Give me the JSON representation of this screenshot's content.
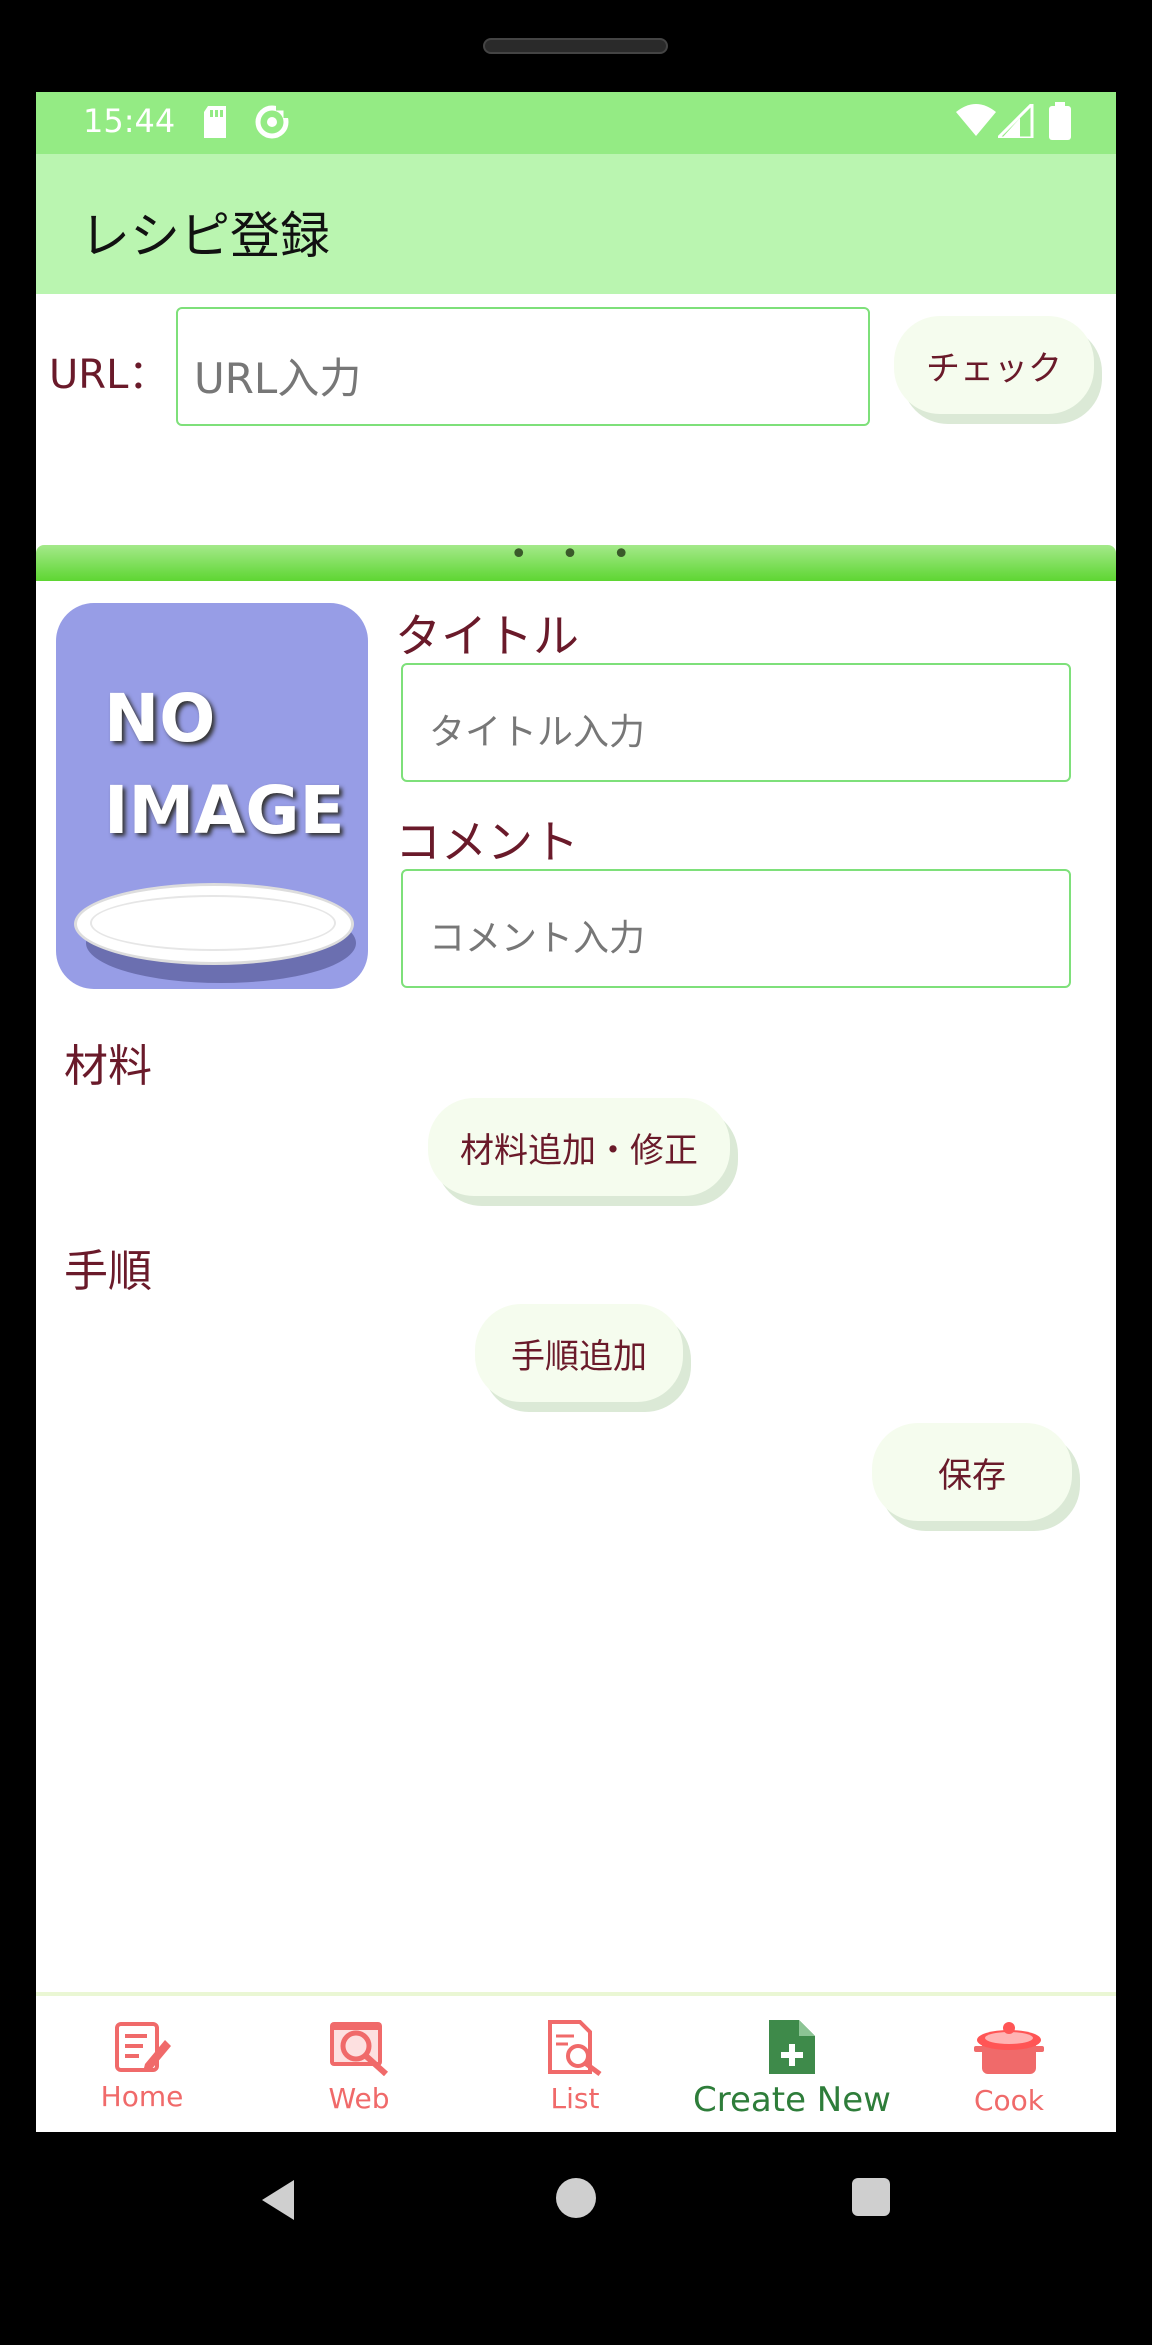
{
  "status": {
    "time": "15:44",
    "icons": [
      "sd-card-icon",
      "sync-icon",
      "wifi-icon",
      "signal-icon",
      "battery-icon"
    ]
  },
  "appbar": {
    "title": "レシピ登録"
  },
  "url_row": {
    "label": "URL：",
    "placeholder": "URL入力",
    "check_label": "チェック"
  },
  "drag_handle": {
    "dots": "• • •"
  },
  "image": {
    "line1": "NO",
    "line2": "IMAGE"
  },
  "title_field": {
    "label": "タイトル",
    "placeholder": "タイトル入力"
  },
  "comment_field": {
    "label": "コメント",
    "placeholder": "コメント入力"
  },
  "ingredients": {
    "label": "材料",
    "button_label": "材料追加・修正"
  },
  "steps": {
    "label": "手順",
    "button_label": "手順追加"
  },
  "save_label": "保存",
  "bottom_nav": {
    "items": [
      {
        "label": "Home",
        "icon": "notepad-edit-icon"
      },
      {
        "label": "Web",
        "icon": "web-search-icon"
      },
      {
        "label": "List",
        "icon": "document-search-icon"
      },
      {
        "label": "Create New",
        "icon": "file-plus-icon",
        "active": true
      },
      {
        "label": "Cook",
        "icon": "cooking-pot-icon"
      }
    ]
  },
  "colors": {
    "status_bar": "#94eb84",
    "app_bar": "#baf5b0",
    "accent_text": "#6a1a2a",
    "nav_inactive": "#f06a6a",
    "nav_active": "#2e7d3a"
  }
}
